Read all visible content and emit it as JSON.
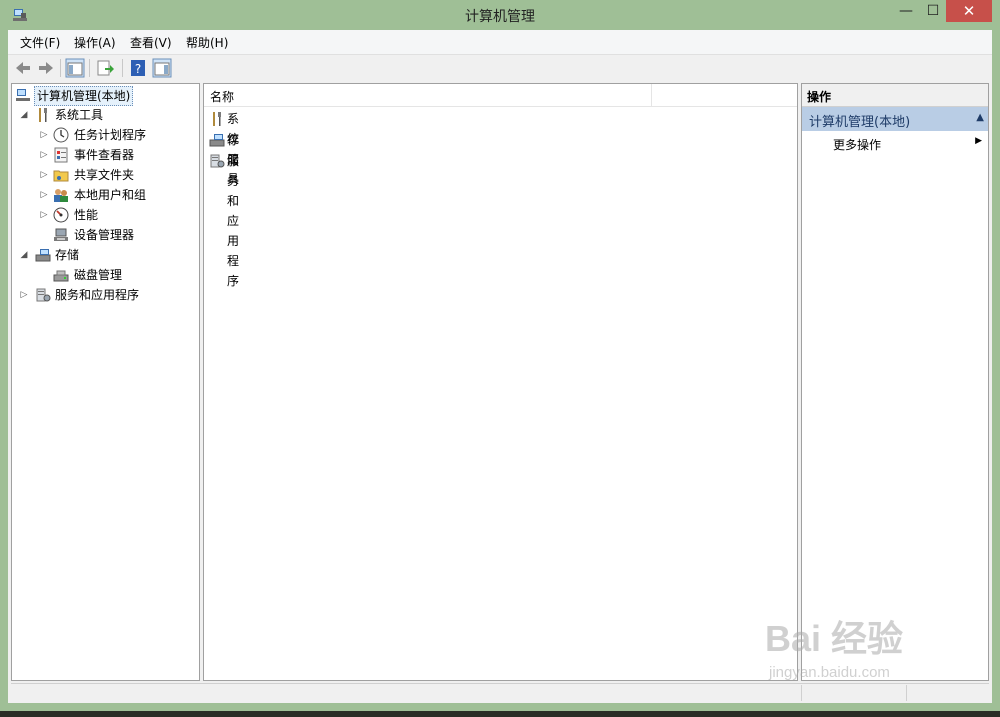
{
  "window": {
    "title": "计算机管理",
    "close_glyph": "✕",
    "min_glyph": "—",
    "max_glyph": "☐"
  },
  "menubar": [
    "文件(F)",
    "操作(A)",
    "查看(V)",
    "帮助(H)"
  ],
  "tree": {
    "root": "计算机管理(本地)",
    "system_tools": "系统工具",
    "task_scheduler": "任务计划程序",
    "event_viewer": "事件查看器",
    "shared_folders": "共享文件夹",
    "local_users": "本地用户和组",
    "performance": "性能",
    "device_manager": "设备管理器",
    "storage": "存储",
    "disk_management": "磁盘管理",
    "services_apps": "服务和应用程序"
  },
  "list": {
    "header_name": "名称",
    "rows": [
      "系统工具",
      "存储",
      "服务和应用程序"
    ]
  },
  "actions": {
    "header": "操作",
    "section": "计算机管理(本地)",
    "more": "更多操作"
  },
  "watermark": {
    "logo": "Bai 经验",
    "url": "jingyan.baidu.com"
  },
  "colors": {
    "title_bar": "#9fbf96",
    "close_button": "#c7504a",
    "action_section": "#b9cde5"
  }
}
